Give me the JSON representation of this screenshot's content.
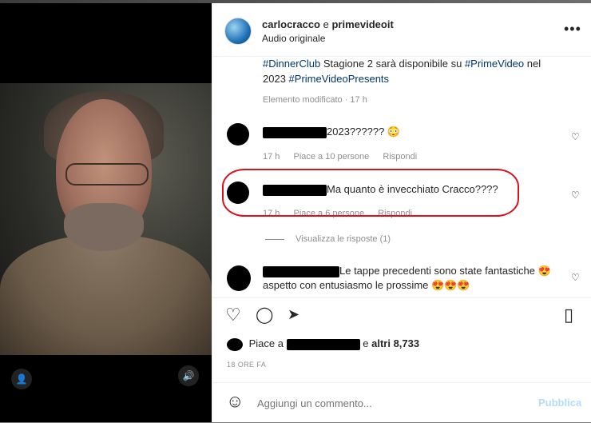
{
  "post": {
    "authors": {
      "user1": "carlocracco",
      "joiner": "e",
      "user2": "primevideoit"
    },
    "audio": "Audio originale",
    "more_label": "•••",
    "caption": [
      {
        "text": "#DinnerClub",
        "tag": true
      },
      {
        "text": " Stagione 2 sarà disponibile su ",
        "tag": false
      },
      {
        "text": "#PrimeVideo",
        "tag": true
      },
      {
        "text": " nel 2023 ",
        "tag": false
      },
      {
        "text": "#PrimeVideoPresents",
        "tag": true
      }
    ],
    "edited": "Elemento modificato · 17 h"
  },
  "comments": [
    {
      "text": "2023?????? 😳",
      "time": "17 h",
      "likes": "Piace a 10 persone",
      "reply": "Rispondi"
    },
    {
      "text": "Ma quanto è invecchiato Cracco????",
      "time": "17 h",
      "likes": "Piace a 6 persone",
      "reply": "Rispondi"
    },
    {
      "text": "Le tappe precedenti sono state fantastiche 😍",
      "text2": "aspetto con entusiasmo le prossime 😍😍😍"
    }
  ],
  "view_replies": "Visualizza le risposte (1)",
  "likes_summary": {
    "prefix": "Piace a",
    "middle": "e",
    "others": "altri 8,733"
  },
  "timestamp": "18 ORE FA",
  "add_comment": {
    "placeholder": "Aggiungi un commento...",
    "publish": "Pubblica"
  },
  "icons": {
    "heart": "♡",
    "comment": "◯",
    "share": "➤",
    "save": "▯",
    "emoji": "☺",
    "user": "👤",
    "volume": "🔊"
  }
}
